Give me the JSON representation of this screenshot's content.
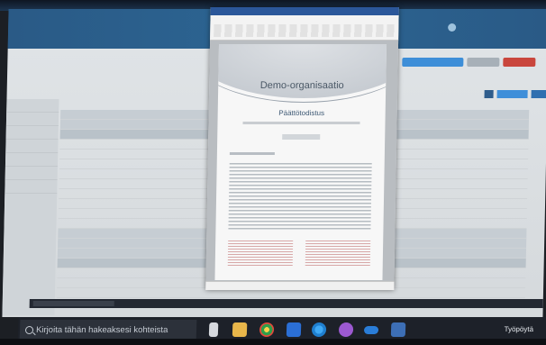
{
  "document": {
    "organization": "Demo-organisaatio",
    "title": "Päättötodistus"
  },
  "taskbar": {
    "search_placeholder": "Kirjoita tähän hakeaksesi kohteista",
    "desktop_label": "Työpöytä"
  }
}
